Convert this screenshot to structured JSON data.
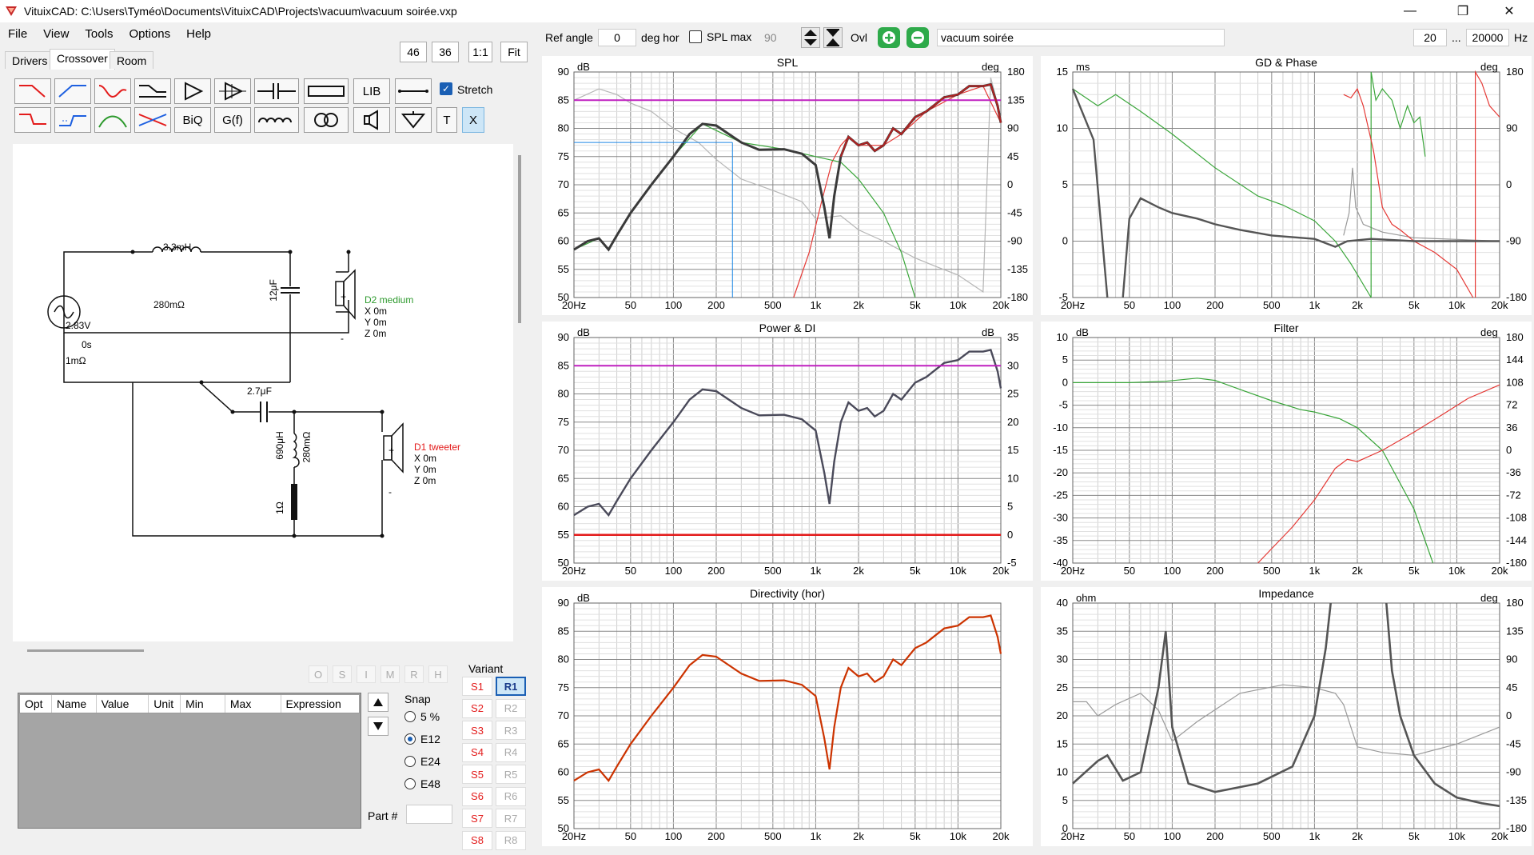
{
  "window": {
    "title": "VituixCAD: C:\\Users\\Tyméo\\Documents\\VituixCAD\\Projects\\vacuum\\vacuum soirée.vxp",
    "controls": [
      "—",
      "❐",
      "✕"
    ]
  },
  "menu": [
    "File",
    "View",
    "Tools",
    "Options",
    "Help"
  ],
  "tabs": [
    "Drivers",
    "Crossover",
    "Room"
  ],
  "toolbar_top": {
    "zoom1": "46",
    "zoom2": "36",
    "ratio": "1:1",
    "fit": "Fit"
  },
  "toolbar_buttons": {
    "lib": "LIB",
    "biq": "BiQ",
    "gf": "G(f)",
    "t": "T",
    "x": "X",
    "stretch": "Stretch"
  },
  "stretch_checked": true,
  "top_controls": {
    "ref_angle_label": "Ref angle",
    "ref_angle_value": "0",
    "deg_hor": "deg hor",
    "spl_max_label": "SPL max",
    "spl_max_value": "90",
    "ovl": "Ovl",
    "name_value": "vacuum soirée",
    "freq_from": "20",
    "freq_sep": "...",
    "freq_to": "20000",
    "freq_unit": "Hz"
  },
  "schematic": {
    "l1_value": "3.3mH",
    "l1_res": "280mΩ",
    "source_v": "2.83V",
    "source_t": "0s",
    "source_r": "1mΩ",
    "c1_value": "12μF",
    "d2_name": "D2 medium",
    "d2_x": "X 0m",
    "d2_y": "Y 0m",
    "d2_z": "Z 0m",
    "c2_value": "2.7μF",
    "l2_value": "690μH",
    "l2_res": "280mΩ",
    "r1_value": "1Ω",
    "d1_name": "D1 tweeter",
    "d1_x": "X 0m",
    "d1_y": "Y 0m",
    "d1_z": "Z 0m",
    "plus": "+",
    "minus": "-"
  },
  "bottom": {
    "ops": [
      "O",
      "S",
      "I",
      "M",
      "R",
      "H"
    ],
    "param_columns": [
      "Opt",
      "Name",
      "Value",
      "Unit",
      "Min",
      "Max",
      "Expression"
    ],
    "snap_label": "Snap",
    "snap_options": [
      "5 %",
      "E12",
      "E24",
      "E48"
    ],
    "snap_selected": "E12",
    "part_label": "Part #",
    "variant_label": "Variant",
    "variants_s": [
      "S1",
      "S2",
      "S3",
      "S4",
      "S5",
      "S6",
      "S7",
      "S8"
    ],
    "variants_r": [
      "R1",
      "R2",
      "R3",
      "R4",
      "R5",
      "R6",
      "R7",
      "R8"
    ],
    "variant_selected": "R1"
  },
  "x_ticks": [
    "20Hz",
    "50",
    "100",
    "200",
    "500",
    "1k",
    "2k",
    "5k",
    "10k",
    "20k"
  ],
  "graphs": {
    "spl": {
      "title": "SPL",
      "left_unit": "dB",
      "right_unit": "deg",
      "left_ticks": [
        "90",
        "85",
        "80",
        "75",
        "70",
        "65",
        "60",
        "55",
        "50"
      ],
      "right_ticks": [
        "180",
        "135",
        "90",
        "45",
        "0",
        "-45",
        "-90",
        "-135",
        "-180"
      ]
    },
    "gd": {
      "title": "GD & Phase",
      "left_unit": "ms",
      "right_unit": "deg",
      "left_ticks": [
        "15",
        "10",
        "5",
        "0",
        "-5"
      ],
      "right_ticks": [
        "180",
        "90",
        "0",
        "-90",
        "-180"
      ]
    },
    "power": {
      "title": "Power & DI",
      "left_unit": "dB",
      "right_unit": "dB",
      "left_ticks": [
        "90",
        "85",
        "80",
        "75",
        "70",
        "65",
        "60",
        "55",
        "50"
      ],
      "right_ticks": [
        "35",
        "30",
        "25",
        "20",
        "15",
        "10",
        "5",
        "0",
        "-5"
      ]
    },
    "filter": {
      "title": "Filter",
      "left_unit": "dB",
      "right_unit": "deg",
      "left_ticks": [
        "10",
        "5",
        "0",
        "-5",
        "-10",
        "-15",
        "-20",
        "-25",
        "-30",
        "-35",
        "-40"
      ],
      "right_ticks": [
        "180",
        "144",
        "108",
        "72",
        "36",
        "0",
        "-36",
        "-72",
        "-108",
        "-144",
        "-180"
      ]
    },
    "directivity": {
      "title": "Directivity (hor)",
      "left_unit": "dB",
      "right_unit": "",
      "left_ticks": [
        "90",
        "85",
        "80",
        "75",
        "70",
        "65",
        "60",
        "55",
        "50"
      ],
      "right_ticks": []
    },
    "impedance": {
      "title": "Impedance",
      "left_unit": "ohm",
      "right_unit": "deg",
      "left_ticks": [
        "40",
        "35",
        "30",
        "25",
        "20",
        "15",
        "10",
        "5",
        "0"
      ],
      "right_ticks": [
        "180",
        "135",
        "90",
        "45",
        "0",
        "-45",
        "-90",
        "-135",
        "-180"
      ]
    }
  },
  "colors": {
    "accent_purple": "#c020c0",
    "red": "#e31b1b",
    "green": "#2e9a2e",
    "grey": "#505060",
    "blue": "#1e88e5"
  }
}
